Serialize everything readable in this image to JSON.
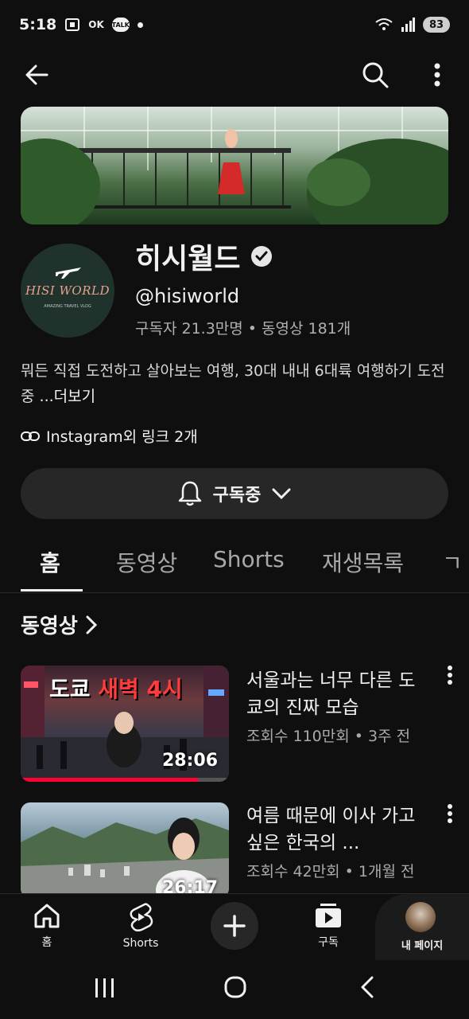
{
  "status": {
    "time": "5:18",
    "battery": "83",
    "talk": "TALK",
    "ok": "OK"
  },
  "channel": {
    "name": "히시월드",
    "handle": "@hisiworld",
    "stats": "구독자 21.3만명 • 동영상 181개",
    "description": "뭐든 직접 도전하고 살아보는 여행, 30대 내내 6대륙 여행하기 도전 중 ",
    "more": "...더보기",
    "link": "Instagram외 링크 2개",
    "avatar_text": "HISI WORLD",
    "avatar_sub": "AMAZING TRAVEL VLOG",
    "subscribe_label": "구독중"
  },
  "tabs": [
    {
      "label": "홈",
      "active": true
    },
    {
      "label": "동영상",
      "active": false
    },
    {
      "label": "Shorts",
      "active": false
    },
    {
      "label": "재생목록",
      "active": false
    },
    {
      "label": "ㄱ",
      "active": false
    }
  ],
  "section": {
    "title": "동영상"
  },
  "videos": [
    {
      "title": "서울과는 너무 다른 도쿄의 진짜 모습",
      "meta": "조회수 110만회 • 3주 전",
      "duration": "28:06",
      "thumb_text_a": "도쿄",
      "thumb_text_b": "새벽 4시",
      "progress": 0.85
    },
    {
      "title": "여름 때문에 이사 가고 싶은 한국의 ...",
      "meta": "조회수 42만회 • 1개월 전",
      "duration": "26:17"
    }
  ],
  "bottom_nav": [
    {
      "label": "홈",
      "icon": "home-icon"
    },
    {
      "label": "Shorts",
      "icon": "shorts-icon"
    },
    {
      "label": "구독",
      "icon": "subscriptions-icon"
    },
    {
      "label": "내 페이지",
      "icon": "avatar"
    }
  ],
  "colors": {
    "background": "#0f0f0f",
    "accent": "#ff0033",
    "surface": "#272727"
  }
}
